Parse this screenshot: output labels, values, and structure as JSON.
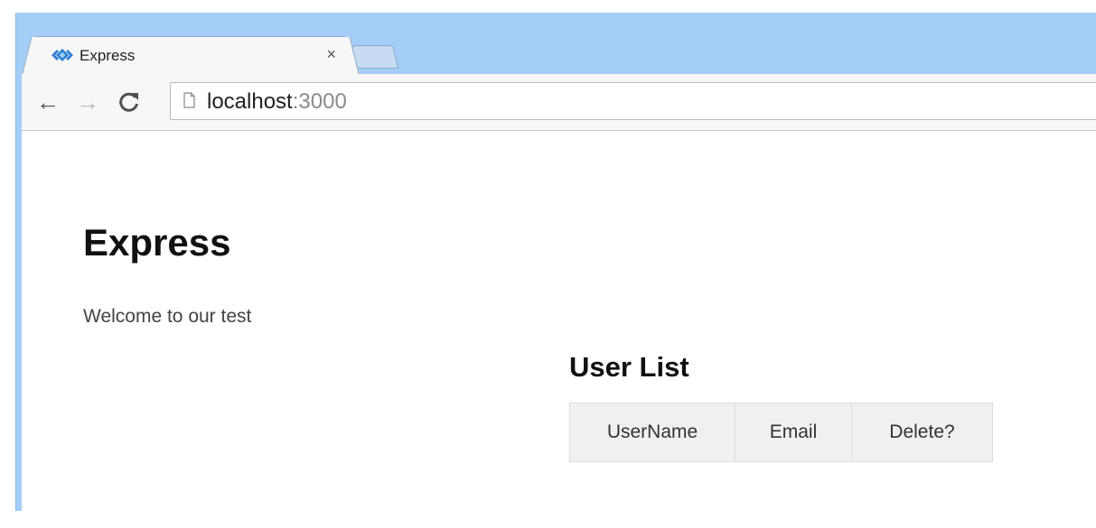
{
  "browser": {
    "tab": {
      "title": "Express",
      "close_glyph": "×",
      "favicon": "express-favicon"
    },
    "new_tab": "new-tab",
    "nav": {
      "back_glyph": "←",
      "forward_glyph": "→",
      "reload_glyph": "C"
    },
    "address": {
      "host": "localhost",
      "port": ":3000",
      "icon": "page-icon"
    },
    "colors": {
      "frame": "#a4cef7",
      "toolbar": "#f7f7f7"
    }
  },
  "page": {
    "title": "Express",
    "welcome": "Welcome to our test",
    "user_list": {
      "heading": "User List",
      "columns": [
        "UserName",
        "Email",
        "Delete?"
      ],
      "header_bg": "#f0f0f0"
    }
  }
}
